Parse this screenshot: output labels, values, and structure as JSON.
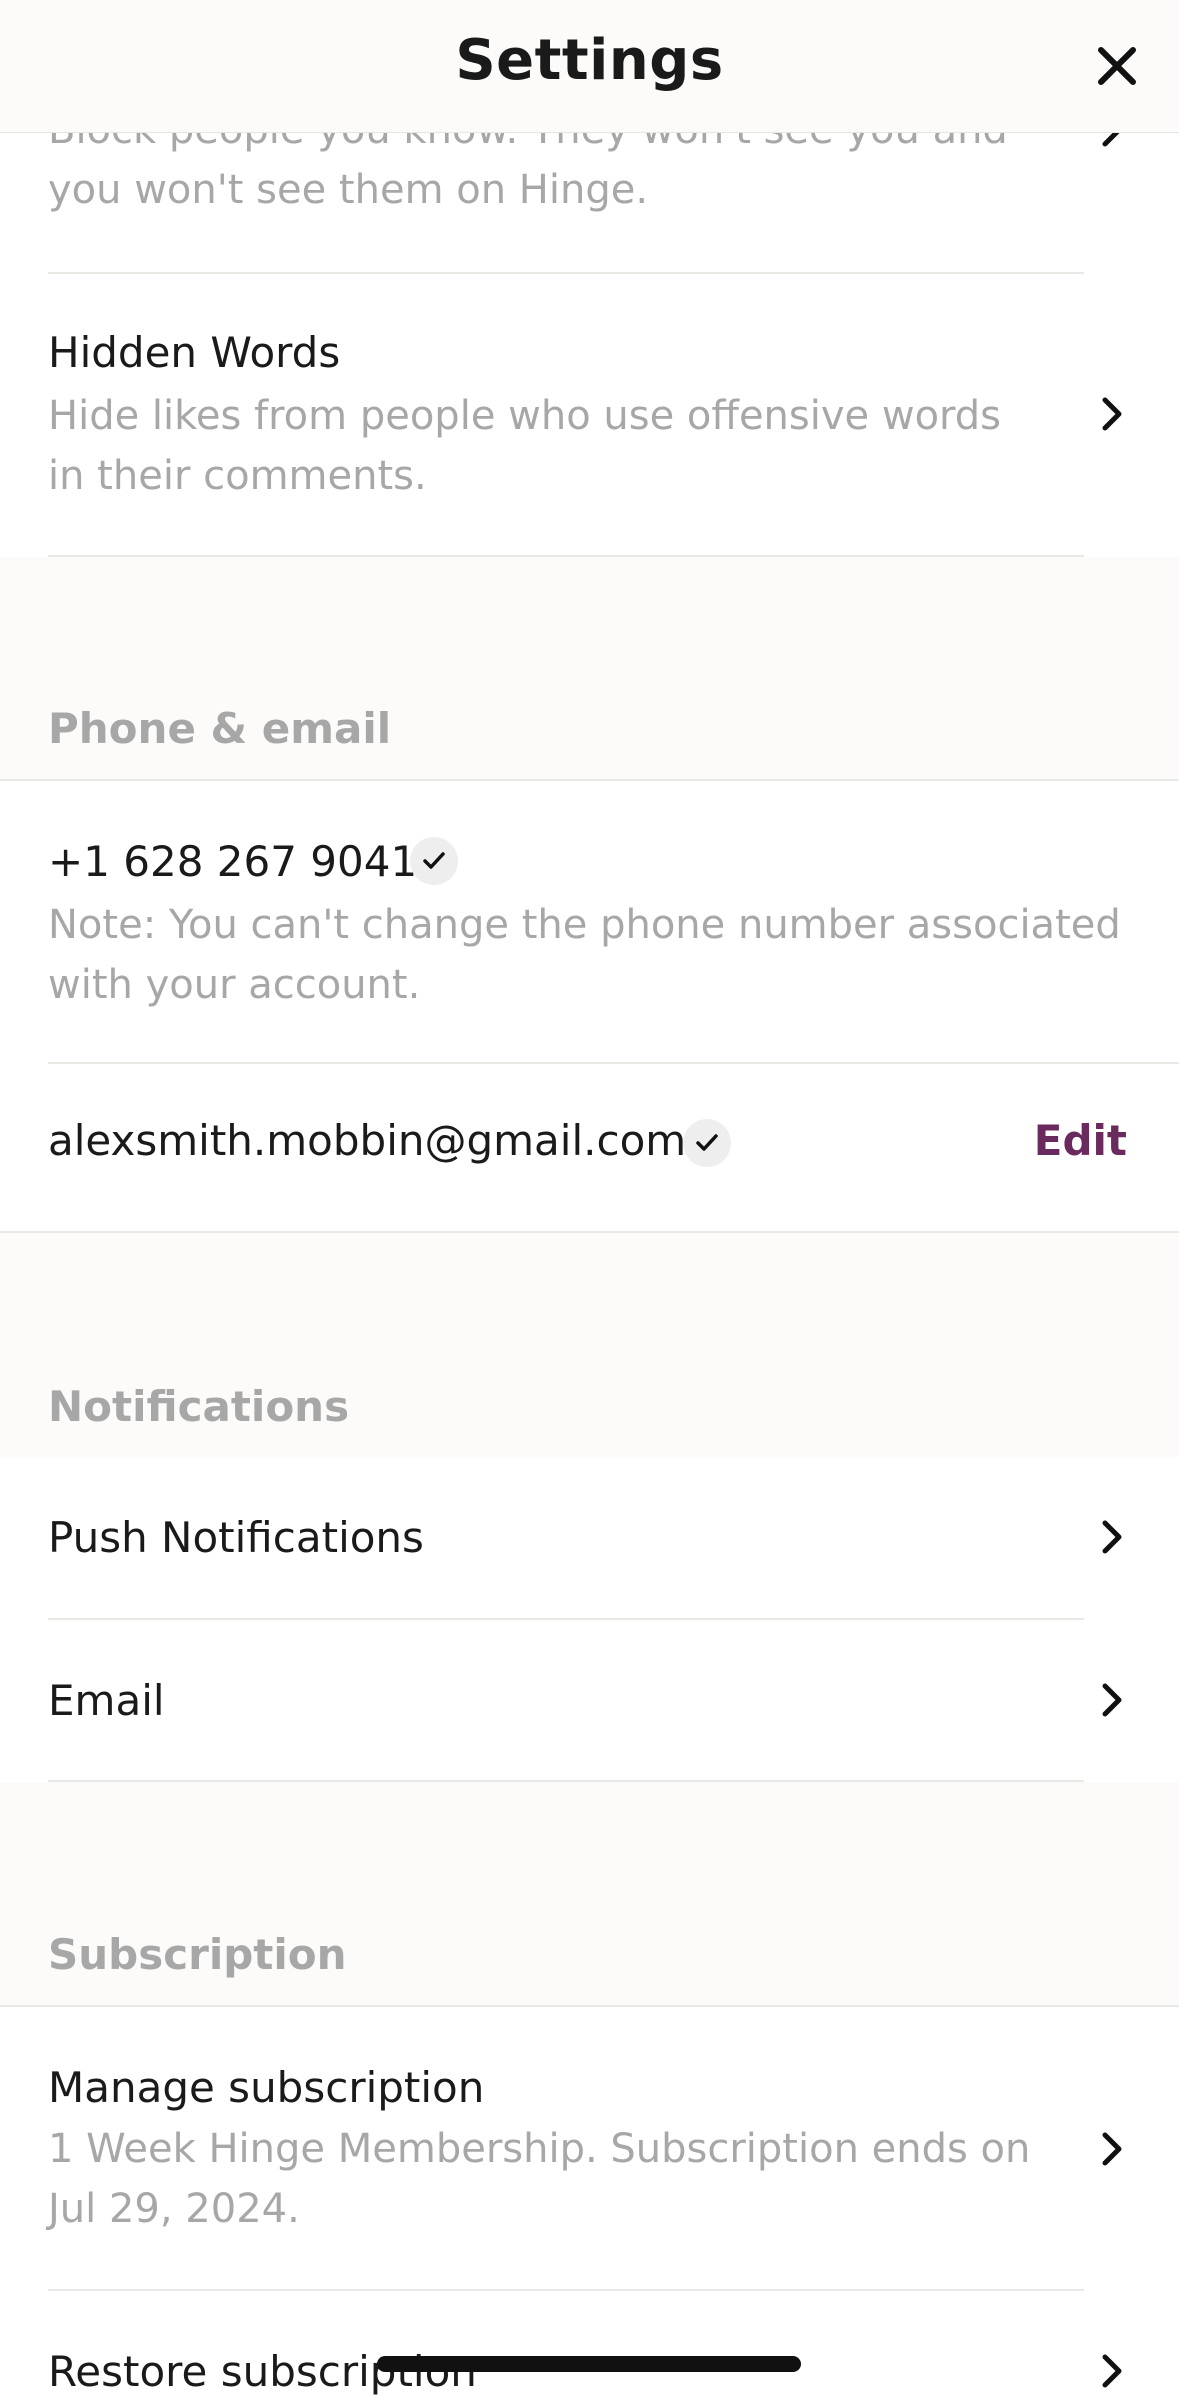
{
  "header": {
    "title": "Settings"
  },
  "blocked": {
    "subtitle": "Block people you know. They won't see you and you won't see them on Hinge."
  },
  "hidden_words": {
    "title": "Hidden Words",
    "subtitle": "Hide likes from people who use offensive words in their comments."
  },
  "phone_email": {
    "section_label": "Phone & email",
    "phone": "+1 628 267 9041",
    "phone_note": "Note: You can't change the phone number associated with your account.",
    "email": "alexsmith.mobbin@gmail.com",
    "edit_label": "Edit"
  },
  "notifications": {
    "section_label": "Notifications",
    "items": [
      {
        "label": "Push Notifications"
      },
      {
        "label": "Email"
      }
    ]
  },
  "subscription": {
    "section_label": "Subscription",
    "manage_title": "Manage subscription",
    "manage_subtitle": "1 Week Hinge Membership. Subscription ends on Jul 29, 2024.",
    "restore_title": "Restore subscription"
  },
  "colors": {
    "accent_edit": "#6b2a5e",
    "section_bg": "#fcfbfa",
    "muted_text": "#a7a7a7"
  }
}
